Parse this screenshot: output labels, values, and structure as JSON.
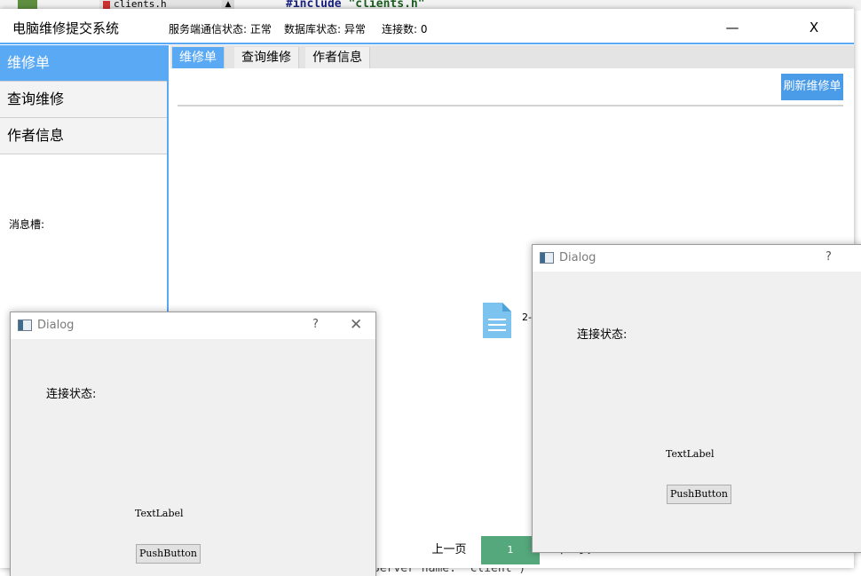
{
  "background_ide": {
    "tab_label": "clients.h",
    "code_keyword": "#include",
    "code_string": "\"clients.h\"",
    "bottom_code": "Server name: \"client\")"
  },
  "main_window": {
    "title": "电脑维修提交系统",
    "server_status": "服务端通信状态: 正常",
    "db_status": "数据库状态: 异常",
    "connections": "连接数: 0",
    "minimize_label": "—",
    "close_label": "X",
    "accent_color": "#5aa9f5"
  },
  "sidebar": {
    "items": [
      {
        "label": "维修单",
        "active": true
      },
      {
        "label": "查询维修",
        "active": false
      },
      {
        "label": "作者信息",
        "active": false
      }
    ],
    "message_label": "消息槽:"
  },
  "tabs": [
    {
      "label": "维修单",
      "active": true
    },
    {
      "label": "查询维修",
      "active": false
    },
    {
      "label": "作者信息",
      "active": false
    }
  ],
  "content": {
    "refresh_label": "刷新维修单",
    "file_icon": "document-icon",
    "file_text": "2-",
    "pager": {
      "prev_label": "上一页",
      "current_page": "1",
      "next_label": "下一页"
    }
  },
  "dialogs": [
    {
      "title": "Dialog",
      "help": "?",
      "close": "✕",
      "status_label": "连接状态:",
      "text_label": "TextLabel",
      "button_label": "PushButton"
    },
    {
      "title": "Dialog",
      "help": "?",
      "status_label": "连接状态:",
      "text_label": "TextLabel",
      "button_label": "PushButton"
    }
  ]
}
